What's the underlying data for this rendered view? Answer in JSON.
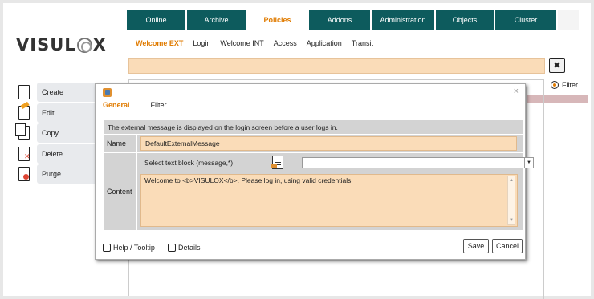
{
  "logo": {
    "text_left": "VISUL",
    "text_right": "X"
  },
  "topnav": {
    "tabs": [
      {
        "label": "Online",
        "active": false
      },
      {
        "label": "Archive",
        "active": false
      },
      {
        "label": "Policies",
        "active": true
      },
      {
        "label": "Addons",
        "active": false
      },
      {
        "label": "Administration",
        "active": false
      },
      {
        "label": "Objects",
        "active": false
      },
      {
        "label": "Cluster",
        "active": false
      }
    ]
  },
  "subnav": {
    "items": [
      {
        "label": "Welcome EXT",
        "active": true
      },
      {
        "label": "Login",
        "active": false
      },
      {
        "label": "Welcome INT",
        "active": false
      },
      {
        "label": "Access",
        "active": false
      },
      {
        "label": "Application",
        "active": false
      },
      {
        "label": "Transit",
        "active": false
      }
    ]
  },
  "search": {
    "value": "",
    "clear_icon": "✖"
  },
  "sidebar": {
    "actions": [
      {
        "label": "Create",
        "icon": "new-document-icon"
      },
      {
        "label": "Edit",
        "icon": "edit-document-icon"
      },
      {
        "label": "Copy",
        "icon": "copy-document-icon"
      },
      {
        "label": "Delete",
        "icon": "delete-document-icon"
      },
      {
        "label": "Purge",
        "icon": "purge-document-icon"
      }
    ]
  },
  "filter_panel": {
    "label": "Filter"
  },
  "dialog": {
    "close_glyph": "×",
    "tabs": [
      {
        "label": "General",
        "active": true
      },
      {
        "label": "Filter",
        "active": false
      }
    ],
    "description": "The external message is displayed on the login screen before a user logs in.",
    "name_label": "Name",
    "name_value": "DefaultExternalMessage",
    "content_label": "Content",
    "select_text_label": "Select text block (message,*)",
    "select_value": "",
    "content_value": "Welcome to <b>VISULOX</b>. Please log in, using valid credentials.",
    "help_label": "Help / Tooltip",
    "details_label": "Details",
    "save_label": "Save",
    "cancel_label": "Cancel"
  },
  "colors": {
    "nav_bg": "#0d5b5d",
    "accent": "#e07b00",
    "input_bg": "#fadcb8",
    "label_bg": "#d3d3d3"
  }
}
